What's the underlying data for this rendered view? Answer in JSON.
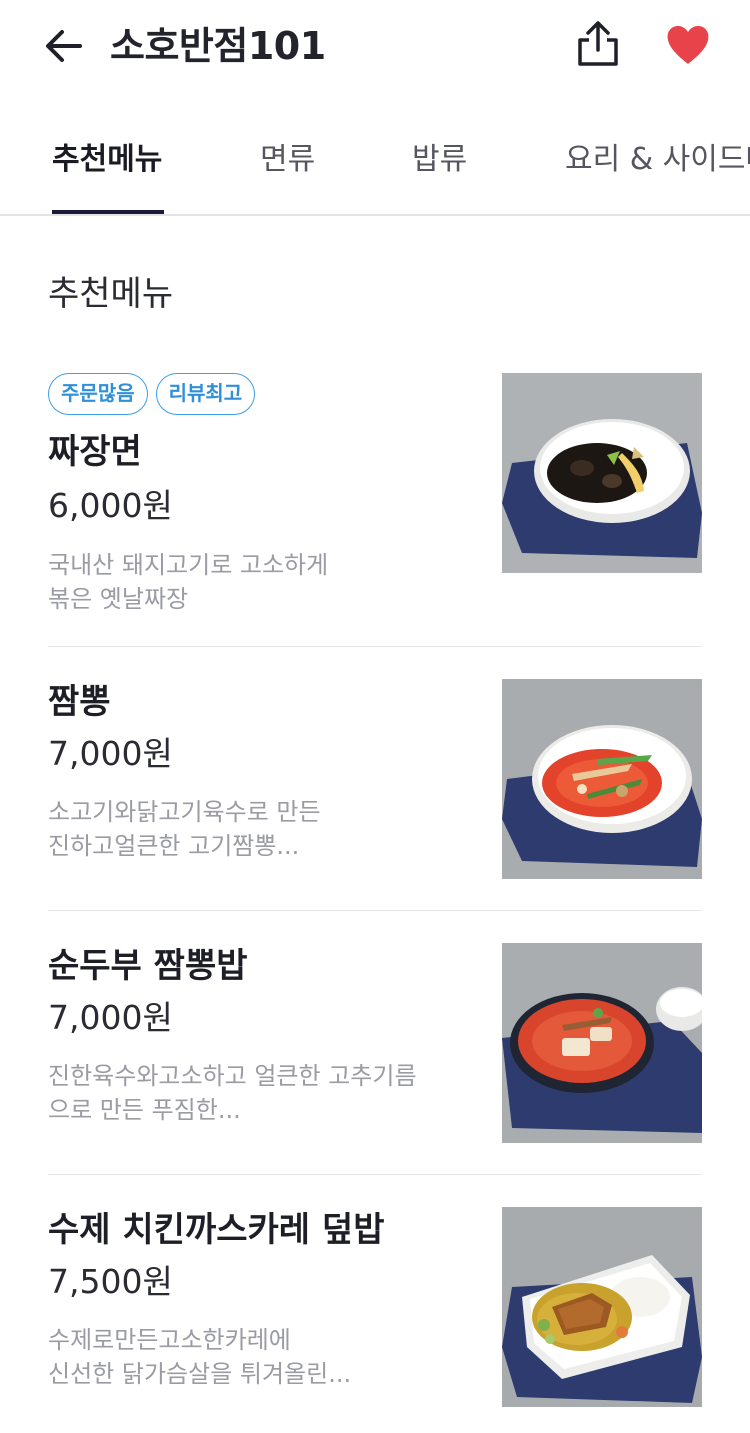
{
  "header": {
    "title": "소호반점101",
    "back_icon": "arrow-left-icon",
    "share_icon": "share-icon",
    "favorite_icon": "heart-icon",
    "favorite_color": "#e8434b"
  },
  "tabs": [
    {
      "label": "추천메뉴",
      "active": true
    },
    {
      "label": "면류",
      "active": false
    },
    {
      "label": "밥류",
      "active": false
    },
    {
      "label": "요리 & 사이드메뉴",
      "active": false
    }
  ],
  "section": {
    "title": "추천메뉴"
  },
  "badge_color": "#3d9ee6",
  "menu_items": [
    {
      "badges": [
        "주문많음",
        "리뷰최고"
      ],
      "name": "짜장면",
      "price": "6,000원",
      "desc_line1": "국내산 돼지고기로 고소하게",
      "desc_line2": "볶은 옛날짜장",
      "image": "jajangmyeon-photo"
    },
    {
      "name": "짬뽕",
      "price": "7,000원",
      "desc_line1": "소고기와닭고기육수로 만든",
      "desc_line2": "진하고얼큰한 고기짬뽕...",
      "image": "jjamppong-photo"
    },
    {
      "name": "순두부 짬뽕밥",
      "price": "7,000원",
      "desc_line1": "진한육수와고소하고 얼큰한 고추기름",
      "desc_line2": "으로  만든 푸짐한...",
      "image": "sundubu-jjamppongbap-photo"
    },
    {
      "name": "수제 치킨까스카레 덮밥",
      "price": "7,500원",
      "desc_line1": "수제로만든고소한카레에",
      "desc_line2": "신선한 닭가슴살을 튀겨올린...",
      "image": "chicken-katsu-curry-photo"
    }
  ]
}
